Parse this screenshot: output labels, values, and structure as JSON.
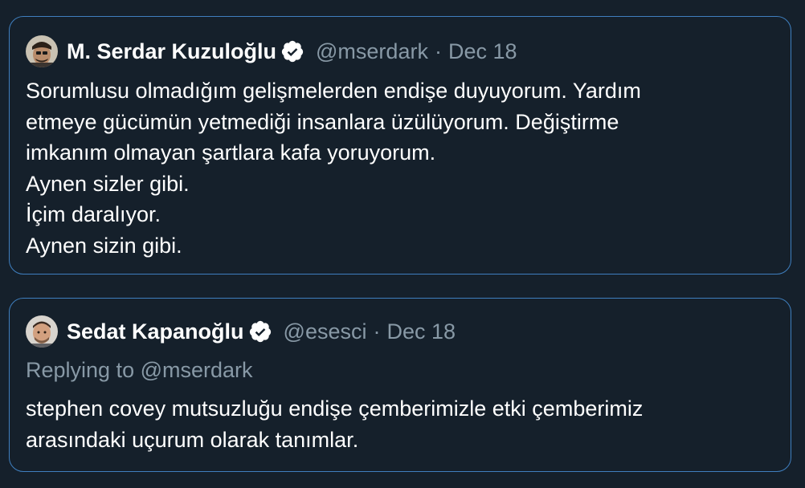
{
  "tweets": [
    {
      "display_name": "M. Serdar Kuzuloğlu",
      "handle": "@mserdark",
      "separator": "·",
      "date": "Dec 18",
      "verified": true,
      "avatar_icon": "user-avatar-photo",
      "lines": [
        "Sorumlusu olmadığım gelişmelerden endişe duyuyorum. Yardım",
        "etmeye gücümün yetmediği insanlara üzülüyorum. Değiştirme",
        "imkanım olmayan şartlara kafa yoruyorum.",
        "Aynen sizler gibi.",
        "İçim daralıyor.",
        "Aynen sizin gibi."
      ]
    },
    {
      "display_name": "Sedat Kapanoğlu",
      "handle": "@esesci",
      "separator": "·",
      "date": "Dec 18",
      "verified": true,
      "avatar_icon": "user-avatar-photo",
      "replying_to": "Replying to @mserdark",
      "lines": [
        "stephen covey mutsuzluğu endişe çemberimizle etki çemberimiz",
        "arasındaki uçurum olarak tanımlar."
      ]
    }
  ],
  "colors": {
    "background": "#15202b",
    "card_border": "#3f7fbf",
    "text_primary": "#ffffff",
    "text_secondary": "#8899a6",
    "verified_badge": "#ffffff"
  }
}
